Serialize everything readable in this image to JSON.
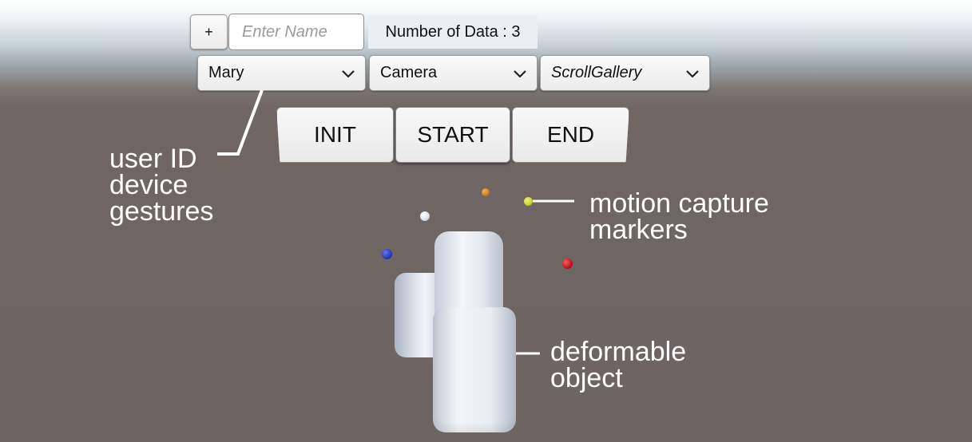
{
  "controls": {
    "add_label": "+",
    "name_placeholder": "Enter Name",
    "data_count": "Number of Data : 3",
    "user_dropdown": "Mary",
    "device_dropdown": "Camera",
    "gesture_dropdown": "ScrollGallery",
    "init_label": "INIT",
    "start_label": "START",
    "end_label": "END"
  },
  "annotations": {
    "selection_line1": "user ID",
    "selection_line2": "device",
    "selection_line3": "gestures",
    "markers_line1": "motion capture",
    "markers_line2": "markers",
    "object_line1": "deformable",
    "object_line2": "object"
  },
  "colors": {
    "marker_orange": "#c9821e",
    "marker_yellow": "#c7d42a",
    "marker_white": "#e6eef5",
    "marker_blue": "#2b36b8",
    "marker_red": "#c4121a",
    "camera_body": "#dfe3ea"
  }
}
